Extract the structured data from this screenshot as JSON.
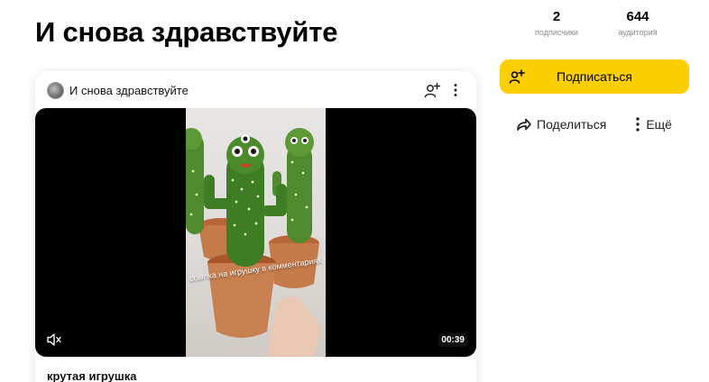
{
  "page": {
    "title": "И снова здравствуйте"
  },
  "stats": {
    "subscribers": {
      "value": "2",
      "label": "подписчики"
    },
    "audience": {
      "value": "644",
      "label": "аудитория"
    }
  },
  "actions": {
    "subscribe_label": "Подписаться",
    "share_label": "Поделиться",
    "more_label": "Ещё"
  },
  "post": {
    "channel_name": "И снова здравствуйте",
    "video": {
      "caption": "ссылка на игрушку в комментариях",
      "duration": "00:39"
    },
    "title": "крутая игрушка"
  },
  "colors": {
    "accent": "#fcd000",
    "video_bg": "#000000"
  },
  "icons": [
    "add-user-icon",
    "share-icon",
    "more-vertical-icon",
    "mute-icon",
    "kebab-icon"
  ]
}
